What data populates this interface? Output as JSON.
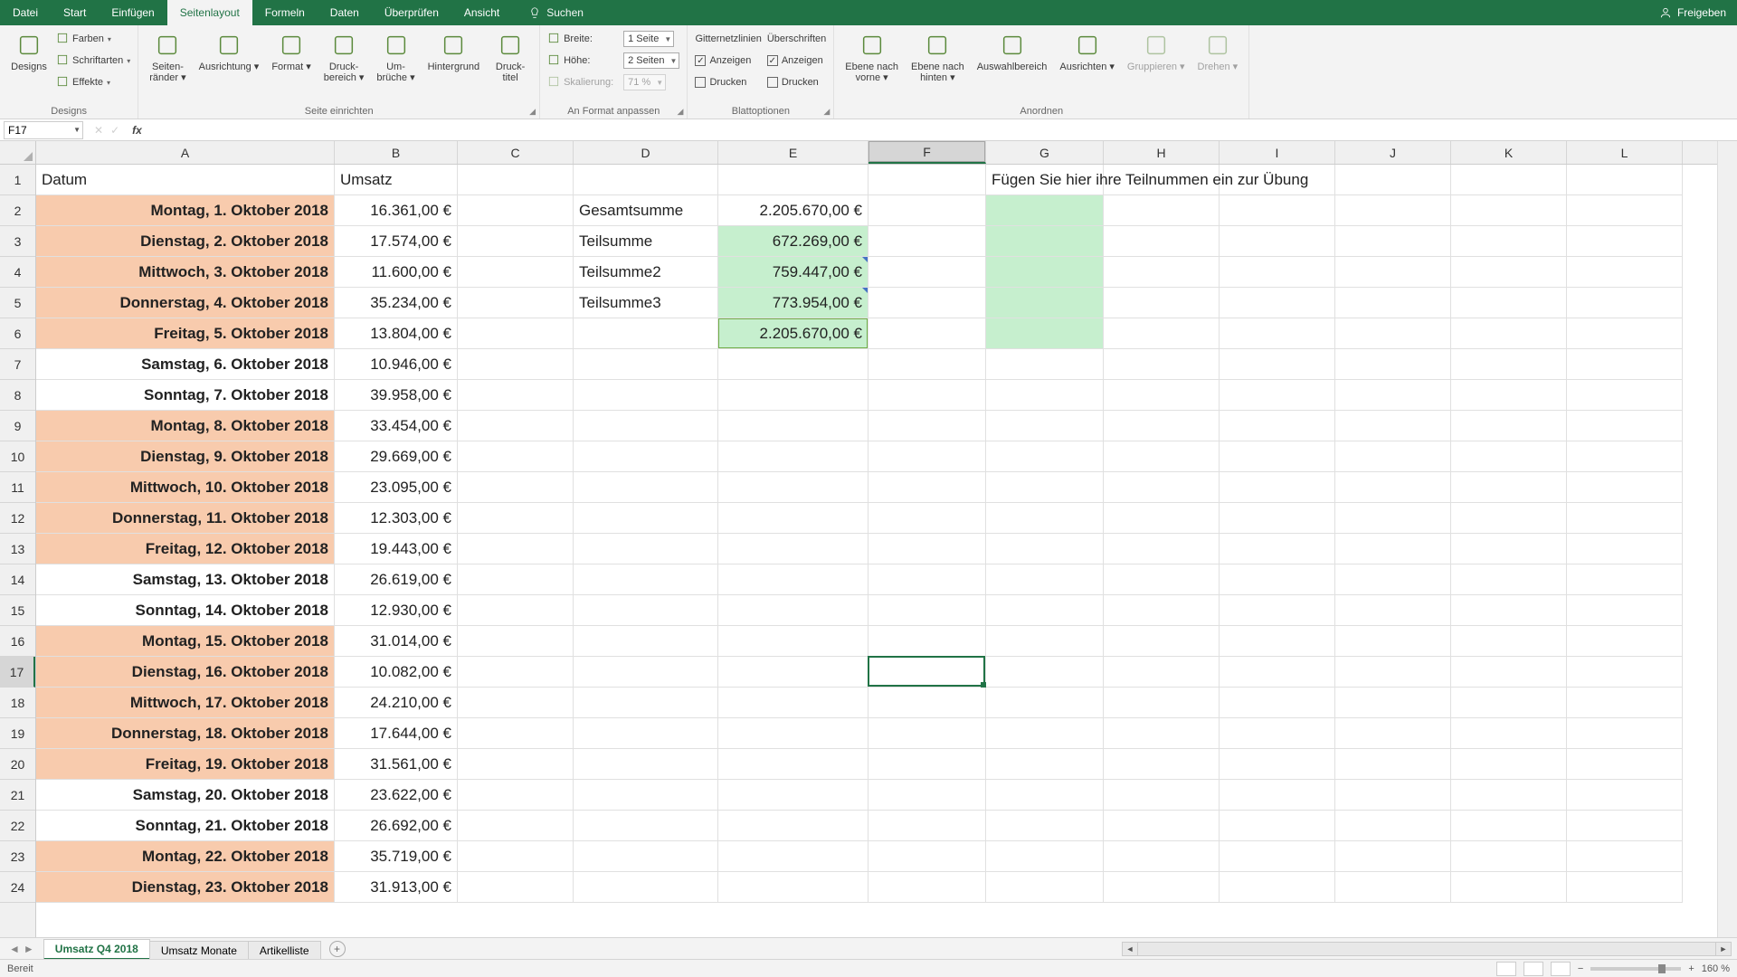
{
  "titlebar": {
    "tabs": [
      "Datei",
      "Start",
      "Einfügen",
      "Seitenlayout",
      "Formeln",
      "Daten",
      "Überprüfen",
      "Ansicht"
    ],
    "activeTab": 3,
    "search": "Suchen",
    "share": "Freigeben"
  },
  "ribbon": {
    "groups": [
      {
        "label": "Designs",
        "items": [
          {
            "k": "big",
            "name": "designs",
            "label": "Designs"
          },
          {
            "k": "rows",
            "rows": [
              {
                "name": "farben",
                "label": "Farben",
                "drop": true,
                "ico": "palette"
              },
              {
                "name": "schriftarten",
                "label": "Schriftarten",
                "drop": true,
                "ico": "font"
              },
              {
                "name": "effekte",
                "label": "Effekte",
                "drop": true,
                "ico": "effects"
              }
            ]
          }
        ]
      },
      {
        "label": "Seite einrichten",
        "launcher": true,
        "items": [
          {
            "k": "big",
            "name": "seitenraender",
            "label": "Seiten-\nränder",
            "drop": true
          },
          {
            "k": "big",
            "name": "ausrichtung",
            "label": "Ausrichtung",
            "drop": true
          },
          {
            "k": "big",
            "name": "format",
            "label": "Format",
            "drop": true
          },
          {
            "k": "big",
            "name": "druckbereich",
            "label": "Druck-\nbereich",
            "drop": true
          },
          {
            "k": "big",
            "name": "umbrueche",
            "label": "Um-\nbrüche",
            "drop": true
          },
          {
            "k": "big",
            "name": "hintergrund",
            "label": "Hintergrund"
          },
          {
            "k": "big",
            "name": "drucktitel",
            "label": "Druck-\ntitel"
          }
        ]
      },
      {
        "label": "An Format anpassen",
        "launcher": true,
        "items": [
          {
            "k": "labeledSelects",
            "rows": [
              {
                "name": "breite",
                "label": "Breite:",
                "value": "1 Seite"
              },
              {
                "name": "hoehe",
                "label": "Höhe:",
                "value": "2 Seiten"
              },
              {
                "name": "skalierung",
                "label": "Skalierung:",
                "value": "71 %",
                "disabled": true
              }
            ]
          }
        ]
      },
      {
        "label": "Blattoptionen",
        "launcher": true,
        "items": [
          {
            "k": "checkCol",
            "title": "Gitternetzlinien",
            "rows": [
              {
                "name": "gitter-anzeigen",
                "label": "Anzeigen",
                "checked": true
              },
              {
                "name": "gitter-drucken",
                "label": "Drucken",
                "checked": false
              }
            ]
          },
          {
            "k": "checkCol",
            "title": "Überschriften",
            "rows": [
              {
                "name": "ueberschr-anzeigen",
                "label": "Anzeigen",
                "checked": true
              },
              {
                "name": "ueberschr-drucken",
                "label": "Drucken",
                "checked": false
              }
            ]
          }
        ]
      },
      {
        "label": "Anordnen",
        "items": [
          {
            "k": "big",
            "name": "ebene-vorne",
            "label": "Ebene nach\nvorne",
            "drop": true
          },
          {
            "k": "big",
            "name": "ebene-hinten",
            "label": "Ebene nach\nhinten",
            "drop": true
          },
          {
            "k": "big",
            "name": "auswahlbereich",
            "label": "Auswahlbereich"
          },
          {
            "k": "big",
            "name": "ausrichten",
            "label": "Ausrichten",
            "drop": true
          },
          {
            "k": "big",
            "name": "gruppieren",
            "label": "Gruppieren",
            "drop": true,
            "disabled": true
          },
          {
            "k": "big",
            "name": "drehen",
            "label": "Drehen",
            "drop": true,
            "disabled": true
          }
        ]
      }
    ]
  },
  "fbar": {
    "cellRef": "F17",
    "formula": ""
  },
  "grid": {
    "columns": [
      "A",
      "B",
      "C",
      "D",
      "E",
      "F",
      "G",
      "H",
      "I",
      "J",
      "K",
      "L"
    ],
    "colWidths": [
      "cA",
      "cB",
      "cC",
      "cD",
      "cE",
      "cF",
      "cG",
      "cH",
      "cI",
      "cJ",
      "cK",
      "cL"
    ],
    "selectedCol": 5,
    "selectedRow": 16,
    "headers": {
      "A": "Datum",
      "B": "Umsatz"
    },
    "instruction": "Fügen Sie hier ihre Teilnummen ein zur Übung",
    "summary": [
      {
        "label": "Gesamtsumme",
        "value": "2.205.670,00 €",
        "green": false
      },
      {
        "label": "Teilsumme",
        "value": "672.269,00 €",
        "green": true
      },
      {
        "label": "Teilsumme2",
        "value": "759.447,00 €",
        "green": true,
        "caret": true
      },
      {
        "label": "Teilsumme3",
        "value": "773.954,00 €",
        "green": true,
        "caret": true
      },
      {
        "label": "",
        "value": "2.205.670,00 €",
        "green": true
      }
    ],
    "rows": [
      {
        "date": "Montag, 1. Oktober 2018",
        "val": "16.361,00 €",
        "hi": true
      },
      {
        "date": "Dienstag, 2. Oktober 2018",
        "val": "17.574,00 €",
        "hi": true
      },
      {
        "date": "Mittwoch, 3. Oktober 2018",
        "val": "11.600,00 €",
        "hi": true
      },
      {
        "date": "Donnerstag, 4. Oktober 2018",
        "val": "35.234,00 €",
        "hi": true
      },
      {
        "date": "Freitag, 5. Oktober 2018",
        "val": "13.804,00 €",
        "hi": true
      },
      {
        "date": "Samstag, 6. Oktober 2018",
        "val": "10.946,00 €",
        "hi": false
      },
      {
        "date": "Sonntag, 7. Oktober 2018",
        "val": "39.958,00 €",
        "hi": false
      },
      {
        "date": "Montag, 8. Oktober 2018",
        "val": "33.454,00 €",
        "hi": true
      },
      {
        "date": "Dienstag, 9. Oktober 2018",
        "val": "29.669,00 €",
        "hi": true
      },
      {
        "date": "Mittwoch, 10. Oktober 2018",
        "val": "23.095,00 €",
        "hi": true
      },
      {
        "date": "Donnerstag, 11. Oktober 2018",
        "val": "12.303,00 €",
        "hi": true
      },
      {
        "date": "Freitag, 12. Oktober 2018",
        "val": "19.443,00 €",
        "hi": true
      },
      {
        "date": "Samstag, 13. Oktober 2018",
        "val": "26.619,00 €",
        "hi": false
      },
      {
        "date": "Sonntag, 14. Oktober 2018",
        "val": "12.930,00 €",
        "hi": false
      },
      {
        "date": "Montag, 15. Oktober 2018",
        "val": "31.014,00 €",
        "hi": true
      },
      {
        "date": "Dienstag, 16. Oktober 2018",
        "val": "10.082,00 €",
        "hi": true
      },
      {
        "date": "Mittwoch, 17. Oktober 2018",
        "val": "24.210,00 €",
        "hi": true
      },
      {
        "date": "Donnerstag, 18. Oktober 2018",
        "val": "17.644,00 €",
        "hi": true
      },
      {
        "date": "Freitag, 19. Oktober 2018",
        "val": "31.561,00 €",
        "hi": true
      },
      {
        "date": "Samstag, 20. Oktober 2018",
        "val": "23.622,00 €",
        "hi": false
      },
      {
        "date": "Sonntag, 21. Oktober 2018",
        "val": "26.692,00 €",
        "hi": false
      },
      {
        "date": "Montag, 22. Oktober 2018",
        "val": "35.719,00 €",
        "hi": true
      },
      {
        "date": "Dienstag, 23. Oktober 2018",
        "val": "31.913,00 €",
        "hi": true
      }
    ]
  },
  "sheets": {
    "tabs": [
      "Umsatz Q4 2018",
      "Umsatz Monate",
      "Artikelliste"
    ],
    "active": 0
  },
  "status": {
    "ready": "Bereit",
    "zoom": "160 %"
  }
}
